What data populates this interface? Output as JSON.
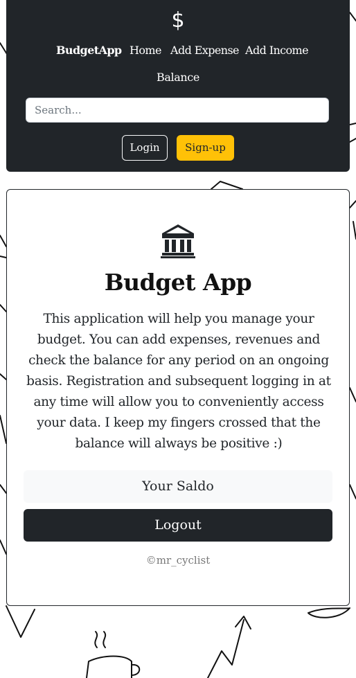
{
  "navbar": {
    "brand_icon": "$",
    "brand": "BudgetApp",
    "links": [
      "Home",
      "Add Expense",
      "Add Income",
      "Balance"
    ],
    "search_placeholder": "Search...",
    "login_label": "Login",
    "signup_label": "Sign-up",
    "background_color": "#212529",
    "signup_color": "#ffc107"
  },
  "card": {
    "icon": "bank-icon",
    "title": "Budget App",
    "description": "This application will help you manage your budget. You can add expenses, revenues and check the balance for any period on an ongoing basis. Registration and subsequent logging in at any time will allow you to conveniently access your data. I keep my fingers crossed that the balance will always be positive :)",
    "saldo_label": "Your Saldo",
    "logout_label": "Logout",
    "copyright": "©mr_cyclist"
  }
}
